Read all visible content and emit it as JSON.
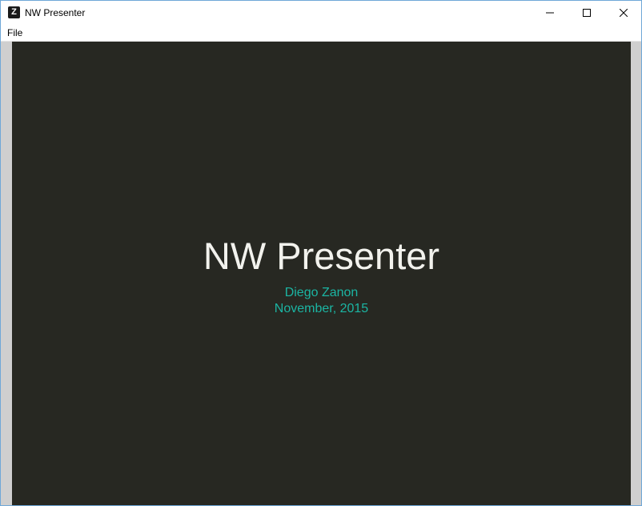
{
  "window": {
    "title": "NW Presenter",
    "icon": "Z"
  },
  "menu": {
    "items": [
      "File"
    ]
  },
  "slide": {
    "title": "NW Presenter",
    "author": "Diego Zanon",
    "date": "November, 2015"
  },
  "colors": {
    "slide_background": "#272822",
    "title_text": "#f2f2ed",
    "accent_text": "#1bb5a3"
  }
}
